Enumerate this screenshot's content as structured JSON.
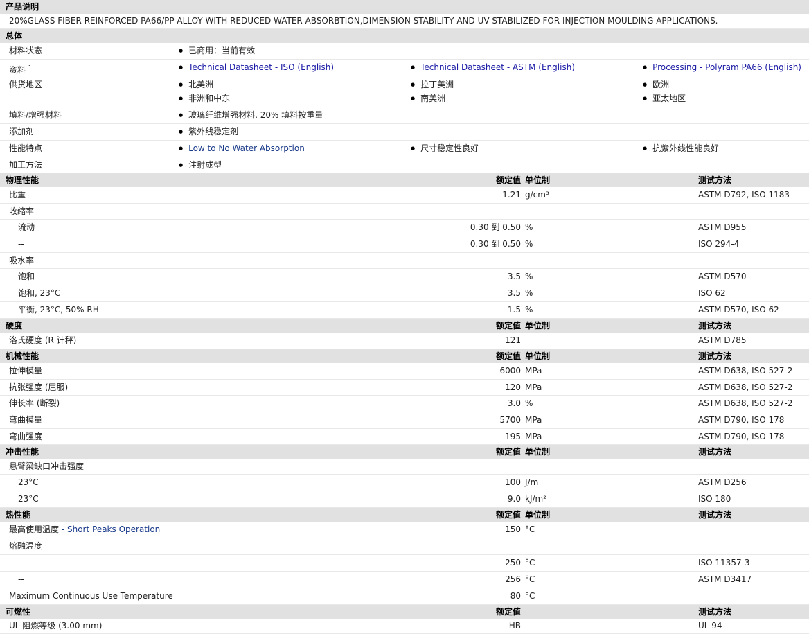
{
  "product_desc": {
    "heading": "产品说明",
    "text": "20%GLASS FIBER REINFORCED PA66/PP ALLOY WITH REDUCED WATER ABSORBTION,DIMENSION STABILITY AND UV STABILIZED FOR INJECTION MOULDING APPLICATIONS."
  },
  "general": {
    "heading": "总体",
    "material_status": {
      "label": "材料状态",
      "value": "已商用：当前有效"
    },
    "documents": {
      "label": "资料",
      "sup": "1",
      "links": [
        "Technical Datasheet - ISO (English)",
        "Technical Datasheet - ASTM (English)",
        "Processing - Polyram PA66 (English)"
      ]
    },
    "regions": {
      "label": "供货地区",
      "items": [
        "北美洲",
        "拉丁美洲",
        "欧洲",
        "非洲和中东",
        "南美洲",
        "亚太地区"
      ]
    },
    "filler": {
      "label": "填料/增强材料",
      "value": "玻璃纤维增强材料, 20% 填料按重量"
    },
    "additive": {
      "label": "添加剂",
      "value": "紫外线稳定剂"
    },
    "features": {
      "label": "性能特点",
      "items": [
        "Low to No Water Absorption",
        "尺寸稳定性良好",
        "抗紫外线性能良好"
      ]
    },
    "processing": {
      "label": "加工方法",
      "value": "注射成型"
    }
  },
  "headers": {
    "nominal": "额定值",
    "unit": "单位制",
    "method": "测试方法"
  },
  "physical": {
    "heading": "物理性能",
    "rows": [
      {
        "label": "比重",
        "value": "1.21",
        "unit": "g/cm³",
        "method": "ASTM D792, ISO 1183",
        "sub": false
      },
      {
        "label": "收缩率",
        "value": "",
        "unit": "",
        "method": "",
        "sub": false
      },
      {
        "label": "流动",
        "value": "0.30 到  0.50",
        "unit": "%",
        "method": "ASTM D955",
        "sub": true
      },
      {
        "label": "--",
        "value": "0.30 到  0.50",
        "unit": "%",
        "method": "ISO 294-4",
        "sub": true
      },
      {
        "label": "吸水率",
        "value": "",
        "unit": "",
        "method": "",
        "sub": false
      },
      {
        "label": "饱和",
        "value": "3.5",
        "unit": "%",
        "method": "ASTM D570",
        "sub": true
      },
      {
        "label": "饱和, 23°C",
        "value": "3.5",
        "unit": "%",
        "method": "ISO 62",
        "sub": true
      },
      {
        "label": "平衡, 23°C, 50% RH",
        "value": "1.5",
        "unit": "%",
        "method": "ASTM D570, ISO 62",
        "sub": true
      }
    ]
  },
  "hardness": {
    "heading": "硬度",
    "rows": [
      {
        "label": "洛氏硬度 (R 计秤)",
        "value": "121",
        "unit": "",
        "method": "ASTM D785",
        "sub": false
      }
    ]
  },
  "mechanical": {
    "heading": "机械性能",
    "rows": [
      {
        "label": "拉伸模量",
        "value": "6000",
        "unit": "MPa",
        "method": "ASTM D638, ISO 527-2",
        "sub": false
      },
      {
        "label": "抗张强度 (屈服)",
        "value": "120",
        "unit": "MPa",
        "method": "ASTM D638, ISO 527-2",
        "sub": false
      },
      {
        "label": "伸长率 (断裂)",
        "value": "3.0",
        "unit": "%",
        "method": "ASTM D638, ISO 527-2",
        "sub": false
      },
      {
        "label": "弯曲模量",
        "value": "5700",
        "unit": "MPa",
        "method": "ASTM D790, ISO 178",
        "sub": false
      },
      {
        "label": "弯曲强度",
        "value": "195",
        "unit": "MPa",
        "method": "ASTM D790, ISO 178",
        "sub": false
      }
    ]
  },
  "impact": {
    "heading": "冲击性能",
    "rows": [
      {
        "label": "悬臂梁缺口冲击强度",
        "value": "",
        "unit": "",
        "method": "",
        "sub": false
      },
      {
        "label": "23°C",
        "value": "100",
        "unit": "J/m",
        "method": "ASTM D256",
        "sub": true
      },
      {
        "label": "23°C",
        "value": "9.0",
        "unit": "kJ/m²",
        "method": "ISO 180",
        "sub": true
      }
    ]
  },
  "thermal": {
    "heading": "热性能",
    "rows": [
      {
        "label": "最高使用温度",
        "label_note": "- Short Peaks Operation",
        "value": "150",
        "unit": "°C",
        "method": "",
        "sub": false
      },
      {
        "label": "熔融温度",
        "value": "",
        "unit": "",
        "method": "",
        "sub": false
      },
      {
        "label": "--",
        "value": "250",
        "unit": "°C",
        "method": "ISO 11357-3",
        "sub": true
      },
      {
        "label": "--",
        "value": "256",
        "unit": "°C",
        "method": "ASTM D3417",
        "sub": true
      },
      {
        "label": "Maximum Continuous Use Temperature",
        "value": "80",
        "unit": "°C",
        "method": "",
        "sub": false
      }
    ]
  },
  "flammability": {
    "heading": "可燃性",
    "rows": [
      {
        "label": "UL 阻燃等级 (3.00 mm)",
        "value": "HB",
        "unit": "",
        "method": "UL 94",
        "sub": false
      }
    ]
  }
}
